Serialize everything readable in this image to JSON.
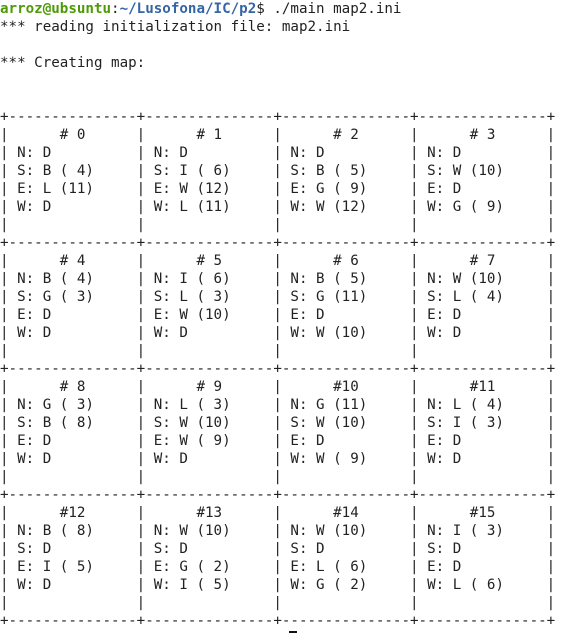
{
  "terminal": {
    "prompt": {
      "user_host": "arroz@ubsuntu",
      "colon": ":",
      "path": "~/Lusofona/IC/p2",
      "symbol": "$",
      "command": " ./main map2.ini"
    },
    "lines": [
      "*** reading initialization file: map2.ini",
      "",
      "*** Creating map:",
      "",
      "",
      "+---------------+---------------+---------------+---------------+",
      "|      # 0      |      # 1      |      # 2      |      # 3      |",
      "| N: D          | N: D          | N: D          | N: D          |",
      "| S: B ( 4)     | S: I ( 6)     | S: B ( 5)     | S: W (10)     |",
      "| E: L (11)     | E: W (12)     | E: G ( 9)     | E: D          |",
      "| W: D          | W: L (11)     | W: W (12)     | W: G ( 9)     |",
      "|               |               |               |               |",
      "+---------------+---------------+---------------+---------------+",
      "|      # 4      |      # 5      |      # 6      |      # 7      |",
      "| N: B ( 4)     | N: I ( 6)     | N: B ( 5)     | N: W (10)     |",
      "| S: G ( 3)     | S: L ( 3)     | S: G (11)     | S: L ( 4)     |",
      "| E: D          | E: W (10)     | E: D          | E: D          |",
      "| W: D          | W: D          | W: W (10)     | W: D          |",
      "|               |               |               |               |",
      "+---------------+---------------+---------------+---------------+",
      "|      # 8      |      # 9      |      #10      |      #11      |",
      "| N: G ( 3)     | N: L ( 3)     | N: G (11)     | N: L ( 4)     |",
      "| S: B ( 8)     | S: W (10)     | S: W (10)     | S: I ( 3)     |",
      "| E: D          | E: W ( 9)     | E: D          | E: D          |",
      "| W: D          | W: D          | W: W ( 9)     | W: D          |",
      "|               |               |               |               |",
      "+---------------+---------------+---------------+---------------+",
      "|      #12      |      #13      |      #14      |      #15      |",
      "| N: B ( 8)     | N: W (10)     | N: W (10)     | N: I ( 3)     |",
      "| S: D          | S: D          | S: D          | S: D          |",
      "| E: I ( 5)     | E: G ( 2)     | E: L ( 6)     | E: D          |",
      "| W: D          | W: I ( 5)     | W: G ( 2)     | W: L ( 6)     |",
      "|               |               |               |               |",
      "+---------------+---------------+---------------+---------------+"
    ]
  },
  "colors": {
    "background": "#ffffff",
    "text": "#222222",
    "prompt_user": "#4e9a06",
    "prompt_path": "#3465a4"
  }
}
